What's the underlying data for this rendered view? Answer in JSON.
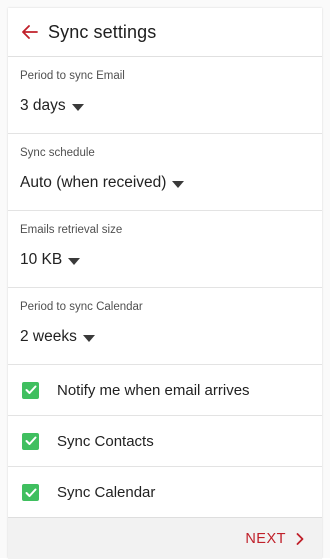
{
  "appbar": {
    "title": "Sync settings",
    "back_icon": "arrow-back-icon"
  },
  "settings": {
    "period_email": {
      "label": "Period to sync Email",
      "value": "3 days"
    },
    "sync_schedule": {
      "label": "Sync schedule",
      "value": "Auto (when received)"
    },
    "retrieval_size": {
      "label": "Emails retrieval size",
      "value": "10 KB"
    },
    "period_calendar": {
      "label": "Period to sync Calendar",
      "value": "2 weeks"
    }
  },
  "checkboxes": {
    "notify": {
      "label": "Notify me when email arrives",
      "checked": true
    },
    "contacts": {
      "label": "Sync Contacts",
      "checked": true
    },
    "calendar": {
      "label": "Sync Calendar",
      "checked": true
    }
  },
  "footer": {
    "next_label": "NEXT",
    "next_icon": "chevron-right-icon"
  },
  "colors": {
    "accent": "#c0202a",
    "checkbox": "#3fbf5f"
  }
}
